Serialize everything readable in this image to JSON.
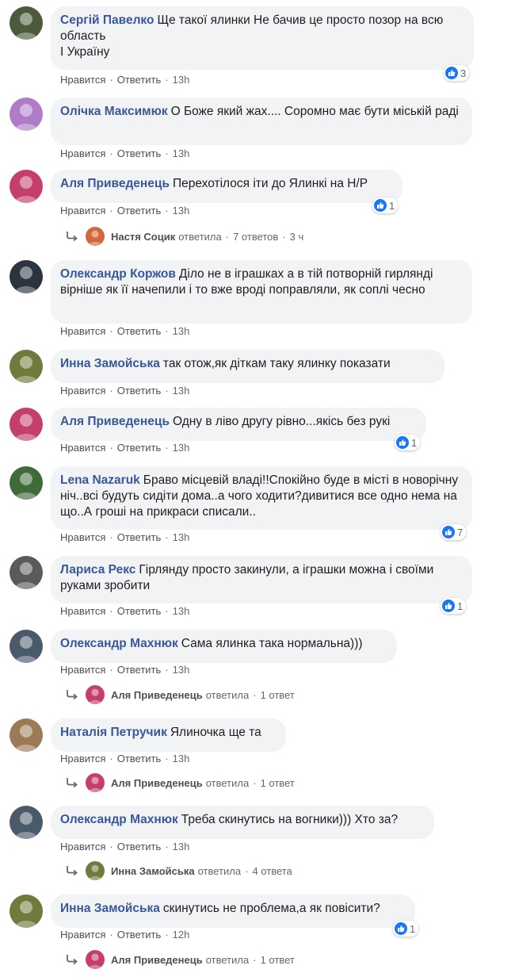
{
  "labels": {
    "like": "Нравится",
    "reply": "Ответить"
  },
  "comments": [
    {
      "author": "Сергій Павелко",
      "text": "Ще такої ялинки Не бачив це просто позор на всю область",
      "text2": "І Україну",
      "time": "13h",
      "likes": "3",
      "avatar_color": "#4b5a3a"
    },
    {
      "author": "Олічка Максимюк",
      "text": "О Боже який жах.... Соромно має бути міській раді",
      "time": "13h",
      "avatar_color": "#b07cc6"
    },
    {
      "author": "Аля Приведенець",
      "text": "Перехотілося іти до Ялинкі на Н/Р",
      "time": "13h",
      "likes": "1",
      "avatar_color": "#c4406b",
      "reply": {
        "name": "Настя Социк",
        "action": "ответила",
        "count": "7 ответов",
        "time": "3 ч",
        "avatar_color": "#d3673c"
      }
    },
    {
      "author": "Олександр Коржов",
      "text": "Діло не в іграшках а в тій потворній гирлянді вірніше як її начепили і то вже вроді поправляли, як соплі чесно",
      "time": "13h",
      "avatar_color": "#2c3440"
    },
    {
      "author": "Инна Замойська",
      "text": "так отож,як діткам таку ялинку показати",
      "time": "13h",
      "avatar_color": "#6f7a3c"
    },
    {
      "author": "Аля Приведенець",
      "text": "Одну в ліво другу рівно...якісь без рукі",
      "time": "13h",
      "likes": "1",
      "avatar_color": "#c4406b"
    },
    {
      "author": "Lena Nazaruk",
      "text": "Браво місцевій владі!!Спокійно буде в місті в новорічну ніч..всі будуть сидіти дома..а чого ходити?дивитися все одно нема на що..А гроші на прикраси списали..",
      "time": "13h",
      "likes": "7",
      "avatar_color": "#3f6b3a"
    },
    {
      "author": "Лариса Рекс",
      "text": "Гірлянду просто закинули, а іграшки можна і своїми руками зробити",
      "time": "13h",
      "likes": "1",
      "avatar_color": "#5a5a5a"
    },
    {
      "author": "Олександр Махнюк",
      "text": "Сама ялинка така нормальна)))",
      "time": "13h",
      "avatar_color": "#4a5a6a",
      "reply": {
        "name": "Аля Приведенець",
        "action": "ответила",
        "count": "1 ответ",
        "avatar_color": "#c4406b"
      }
    },
    {
      "author": "Наталія Петручик",
      "text": "Ялиночка ще та",
      "time": "13h",
      "avatar_color": "#9c7a55",
      "reply": {
        "name": "Аля Приведенець",
        "action": "ответила",
        "count": "1 ответ",
        "avatar_color": "#c4406b"
      }
    },
    {
      "author": "Олександр Махнюк",
      "text": "Треба скинутись на вогники))) Хто за?",
      "time": "13h",
      "avatar_color": "#4a5a6a",
      "reply": {
        "name": "Инна Замойська",
        "action": "ответила",
        "count": "4 ответа",
        "avatar_color": "#6f7a3c"
      }
    },
    {
      "author": "Инна Замойська",
      "text": "скинутись не проблема,а як повісити?",
      "time": "12h",
      "likes": "1",
      "avatar_color": "#6f7a3c",
      "reply": {
        "name": "Аля Приведенець",
        "action": "ответила",
        "count": "1 ответ",
        "avatar_color": "#c4406b"
      }
    }
  ]
}
